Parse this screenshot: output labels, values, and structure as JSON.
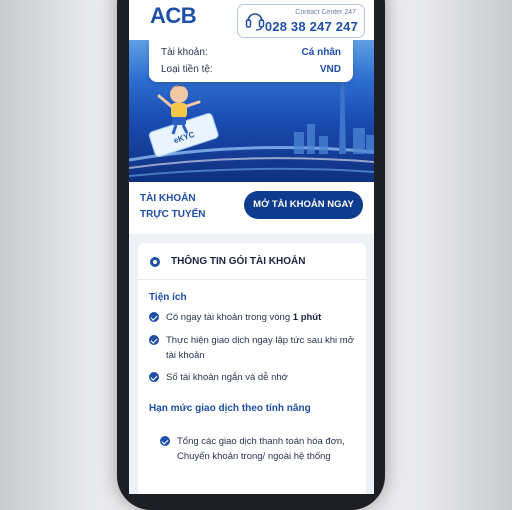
{
  "header": {
    "logo_text": "ACB",
    "contact_label": "Contact Center 247",
    "contact_phone": "028 38 247 247"
  },
  "account_card": {
    "account_label": "Tài khoản:",
    "account_value": "Cá nhân",
    "currency_label": "Loại tiền tệ:",
    "currency_value": "VND"
  },
  "banner": {
    "card_text": "eKYC"
  },
  "cta": {
    "title_line1": "TÀI KHOẢN",
    "title_line2": "TRỰC TUYẾN",
    "button_label": "MỞ TÀI KHOẢN NGAY"
  },
  "package": {
    "title": "THÔNG TIN GÓI TÀI KHOẢN",
    "utilities_title": "Tiện ích",
    "utilities": [
      {
        "text": "Có ngay tài khoản trong vòng ",
        "bold": "1 phút"
      },
      {
        "text": "Thực hiện giao dịch ngay lập tức sau khi mở tài khoản",
        "bold": ""
      },
      {
        "text": "Số tài khoản ngắn và dễ nhớ",
        "bold": ""
      }
    ],
    "limits_title": "Hạn mức giao dịch theo tính năng",
    "limits": [
      {
        "text": "Tổng các giao dịch thanh toán hóa đơn, Chuyển khoản trong/ ngoài hệ thống"
      }
    ]
  },
  "colors": {
    "brand": "#1f4fa6",
    "button": "#0d3b8e",
    "phone_frame": "#1d1f24"
  }
}
